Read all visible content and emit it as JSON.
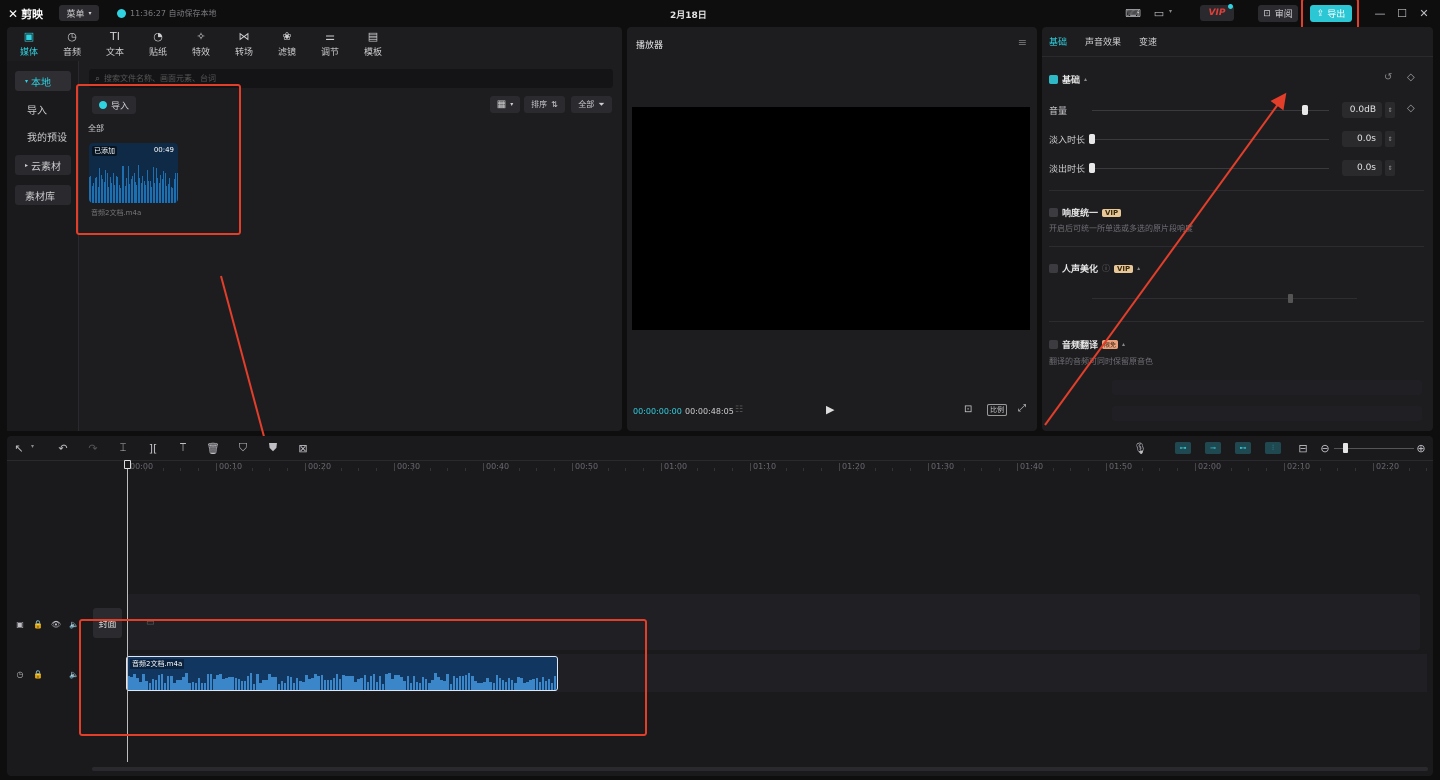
{
  "app": {
    "logo": "剪映",
    "menu": "菜单",
    "autosave": "11:36:27 自动保存本地",
    "date": "2月18日",
    "vip": "VIP",
    "review": "审阅",
    "export": "导出"
  },
  "media_tabs": [
    {
      "label": "媒体",
      "icon": "media-icon",
      "glyph": "▣",
      "active": true
    },
    {
      "label": "音频",
      "icon": "audio-icon",
      "glyph": "◷"
    },
    {
      "label": "文本",
      "icon": "text-icon",
      "glyph": "TI"
    },
    {
      "label": "贴纸",
      "icon": "sticker-icon",
      "glyph": "◔"
    },
    {
      "label": "特效",
      "icon": "effects-icon",
      "glyph": "✧"
    },
    {
      "label": "转场",
      "icon": "transition-icon",
      "glyph": "⋈"
    },
    {
      "label": "滤镜",
      "icon": "filter-icon",
      "glyph": "❀"
    },
    {
      "label": "调节",
      "icon": "adjust-icon",
      "glyph": "⚌"
    },
    {
      "label": "模板",
      "icon": "template-icon",
      "glyph": "▤"
    }
  ],
  "sidebar": {
    "local": "本地",
    "import": "导入",
    "presets": "我的预设",
    "cloud": "云素材",
    "library": "素材库"
  },
  "media": {
    "search_placeholder": "搜索文件名称、画面元素、台词",
    "import_btn": "导入",
    "sort": "排序",
    "filter": "全部",
    "section": "全部",
    "clip_badge": "已添加",
    "clip_duration": "00:49",
    "clip_name": "音频2文档.m4a"
  },
  "player": {
    "title": "播放器",
    "current": "00:00:00:00",
    "total": "00:00:48:05",
    "ratio": "比例"
  },
  "props": {
    "tabs": [
      "基础",
      "声音效果",
      "变速"
    ],
    "basic": "基础",
    "volume_label": "音量",
    "volume_value": "0.0dB",
    "fadein_label": "淡入时长",
    "fadein_value": "0.0s",
    "fadeout_label": "淡出时长",
    "fadeout_value": "0.0s",
    "loudness": "响度统一",
    "loudness_desc": "开启后可统一所单选或多选的原片段响度",
    "voice_beauty": "人声美化",
    "translate": "音频翻译",
    "translate_badge": "限免",
    "translate_desc": "翻译的音频可同时保留原音色",
    "vip": "VIP",
    "volume_level": 0.9,
    "fadein_level": 0,
    "fadeout_level": 0
  },
  "timeline": {
    "ticks": [
      "00:00",
      "00:10",
      "00:20",
      "00:30",
      "00:40",
      "00:50",
      "01:00",
      "01:10",
      "01:20",
      "01:30",
      "01:40",
      "01:50",
      "02:00",
      "02:10",
      "02:20"
    ],
    "cover": "封面",
    "clip_name": "音频2文档.m4a"
  }
}
